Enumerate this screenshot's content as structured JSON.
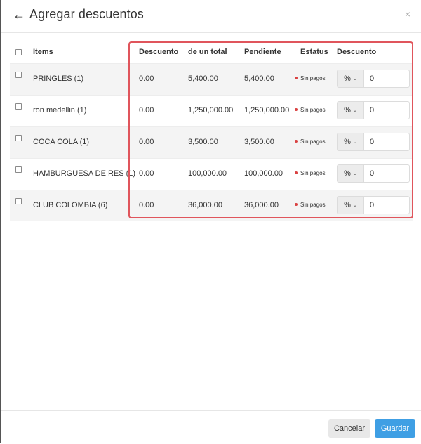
{
  "header": {
    "title": "Agregar descuentos",
    "back_icon": "←",
    "close_icon": "×"
  },
  "table": {
    "columns": {
      "items": "Items",
      "descuento": "Descuento",
      "total": "de un total",
      "pendiente": "Pendiente",
      "estatus": "Estatus",
      "descuento_input": "Descuento"
    },
    "rows": [
      {
        "item": "PRINGLES (1)",
        "descuento": "0.00",
        "total": "5,400.00",
        "pendiente": "5,400.00",
        "status": "Sin pagos",
        "unit": "%",
        "value": "0"
      },
      {
        "item": "ron medellin (1)",
        "descuento": "0.00",
        "total": "1,250,000.00",
        "pendiente": "1,250,000.00",
        "status": "Sin pagos",
        "unit": "%",
        "value": "0"
      },
      {
        "item": "COCA COLA (1)",
        "descuento": "0.00",
        "total": "3,500.00",
        "pendiente": "3,500.00",
        "status": "Sin pagos",
        "unit": "%",
        "value": "0"
      },
      {
        "item": "HAMBURGUESA DE RES (1)",
        "descuento": "0.00",
        "total": "100,000.00",
        "pendiente": "100,000.00",
        "status": "Sin pagos",
        "unit": "%",
        "value": "0"
      },
      {
        "item": "CLUB COLOMBIA (6)",
        "descuento": "0.00",
        "total": "36,000.00",
        "pendiente": "36,000.00",
        "status": "Sin pagos",
        "unit": "%",
        "value": "0"
      }
    ]
  },
  "footer": {
    "cancel_label": "Cancelar",
    "save_label": "Guardar"
  },
  "colors": {
    "primary": "#3f9fe4",
    "highlight": "#e0555c",
    "status_dot": "#d94141"
  }
}
